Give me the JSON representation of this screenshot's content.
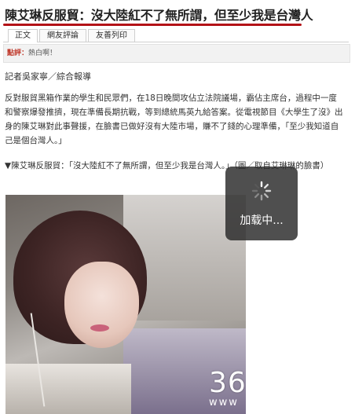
{
  "headline": "陳艾琳反服貿：沒大陸紅不了無所謂，但至少我是台灣人",
  "tabs": [
    {
      "label": "正文"
    },
    {
      "label": "網友評論"
    },
    {
      "label": "友善列印"
    }
  ],
  "hotbar": {
    "tag": "點評：",
    "text": "熱白啊！"
  },
  "byline": "記者吳家寧／綜合報導",
  "paragraph": "反對服貿黑箱作業的學生和民眾們，在18日晚間攻佔立法院議場，霸佔主席台，過程中一度和警察爆發推擠，現在準備長期抗戰，等到總統馬英九給答案。從電視節目《大學生了沒》出身的陳艾琳對此事聲援，在臉書已做好沒有大陸市場，賺不了錢的心理準備，「至少我知道自己是個台灣人。」",
  "caption": "▼陳艾琳反服貿：「沒大陸紅不了無所謂，但至少我是台灣人。」（圖／取自艾琳琳的臉書）",
  "overlay": {
    "text": "加载中..."
  },
  "watermark": {
    "brand": "36",
    "url": "www"
  },
  "colors": {
    "accent_rule": "#b31217",
    "hot_tag": "#c0392b"
  }
}
